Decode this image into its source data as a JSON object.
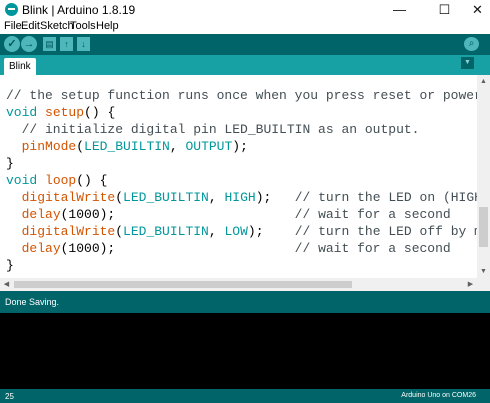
{
  "window": {
    "title": "Blink | Arduino 1.8.19",
    "minimize": "—",
    "maximize": "☐",
    "close": "✕"
  },
  "menu": [
    "File",
    "Edit",
    "Sketch",
    "Tools",
    "Help"
  ],
  "toolbar": {
    "verify": "✓",
    "upload": "→",
    "new": "▤",
    "open": "↑",
    "save": "↓",
    "serial_monitor": "⌕"
  },
  "tabs": [
    {
      "label": "Blink"
    }
  ],
  "tab_menu": "▼",
  "code": [
    [
      {
        "t": "// the setup function runs once when you press reset or power",
        "c": "comment"
      }
    ],
    [
      {
        "t": "void",
        "c": "keyword"
      },
      {
        "t": " ",
        "c": "plain"
      },
      {
        "t": "setup",
        "c": "func"
      },
      {
        "t": "() {",
        "c": "plain"
      }
    ],
    [
      {
        "t": "  // initialize digital pin LED_BUILTIN as an output.",
        "c": "comment"
      }
    ],
    [
      {
        "t": "  ",
        "c": "plain"
      },
      {
        "t": "pinMode",
        "c": "func"
      },
      {
        "t": "(",
        "c": "plain"
      },
      {
        "t": "LED_BUILTIN",
        "c": "const"
      },
      {
        "t": ", ",
        "c": "plain"
      },
      {
        "t": "OUTPUT",
        "c": "const"
      },
      {
        "t": ");",
        "c": "plain"
      }
    ],
    [
      {
        "t": "}",
        "c": "plain"
      }
    ],
    [
      {
        "t": "void",
        "c": "keyword"
      },
      {
        "t": " ",
        "c": "plain"
      },
      {
        "t": "loop",
        "c": "func"
      },
      {
        "t": "() {",
        "c": "plain"
      }
    ],
    [
      {
        "t": "  ",
        "c": "plain"
      },
      {
        "t": "digitalWrite",
        "c": "func"
      },
      {
        "t": "(",
        "c": "plain"
      },
      {
        "t": "LED_BUILTIN",
        "c": "const"
      },
      {
        "t": ", ",
        "c": "plain"
      },
      {
        "t": "HIGH",
        "c": "const"
      },
      {
        "t": ");   ",
        "c": "plain"
      },
      {
        "t": "// turn the LED on (HIGH",
        "c": "comment"
      }
    ],
    [
      {
        "t": "  ",
        "c": "plain"
      },
      {
        "t": "delay",
        "c": "func"
      },
      {
        "t": "(1000);                       ",
        "c": "plain"
      },
      {
        "t": "// wait for a second",
        "c": "comment"
      }
    ],
    [
      {
        "t": "  ",
        "c": "plain"
      },
      {
        "t": "digitalWrite",
        "c": "func"
      },
      {
        "t": "(",
        "c": "plain"
      },
      {
        "t": "LED_BUILTIN",
        "c": "const"
      },
      {
        "t": ", ",
        "c": "plain"
      },
      {
        "t": "LOW",
        "c": "const"
      },
      {
        "t": ");    ",
        "c": "plain"
      },
      {
        "t": "// turn the LED off by ma",
        "c": "comment"
      }
    ],
    [
      {
        "t": "  ",
        "c": "plain"
      },
      {
        "t": "delay",
        "c": "func"
      },
      {
        "t": "(1000);                       ",
        "c": "plain"
      },
      {
        "t": "// wait for a second",
        "c": "comment"
      }
    ],
    [
      {
        "t": "}",
        "c": "plain"
      }
    ]
  ],
  "status": {
    "message": "Done Saving."
  },
  "footer": {
    "line": "25",
    "board": "Arduino Uno on COM26"
  },
  "colors": {
    "teal_dark": "#006468",
    "teal_tab": "#17a1a5",
    "keyword": "#00979c",
    "function": "#d35400",
    "comment": "#434f54"
  }
}
